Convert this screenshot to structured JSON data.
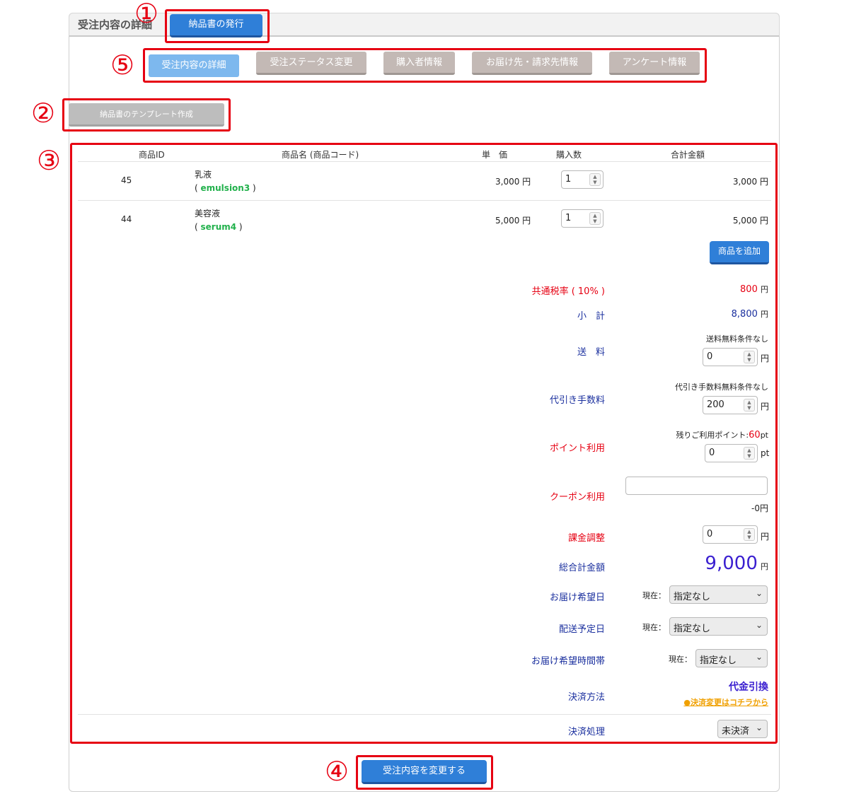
{
  "header": {
    "title": "受注内容の詳細",
    "issue_button": "納品書の発行"
  },
  "callouts": [
    "①",
    "②",
    "③",
    "④",
    "⑤"
  ],
  "tabs": [
    {
      "label": "受注内容の詳細",
      "active": true
    },
    {
      "label": "受注ステータス変更",
      "active": false
    },
    {
      "label": "購入者情報",
      "active": false
    },
    {
      "label": "お届け先・請求先情報",
      "active": false
    },
    {
      "label": "アンケート情報",
      "active": false
    }
  ],
  "template_button": "納品書のテンプレート作成",
  "table": {
    "headers": [
      "商品ID",
      "商品名 (商品コード)",
      "単　価",
      "購入数",
      "合計金額"
    ],
    "rows": [
      {
        "id": "45",
        "name": "乳液",
        "code": "emulsion3",
        "price": "3,000 円",
        "qty": "1",
        "total": "3,000 円"
      },
      {
        "id": "44",
        "name": "美容液",
        "code": "serum4",
        "price": "5,000 円",
        "qty": "1",
        "total": "5,000 円"
      }
    ],
    "add_button": "商品を追加",
    "paren_open": "( ",
    "paren_close": " )"
  },
  "summary": {
    "tax_label": "共通税率 ( 10% )",
    "tax_value": "800",
    "subtotal_label": "小　計",
    "subtotal_value": "8,800",
    "shipping_label": "送　料",
    "shipping_note": "送料無料条件なし",
    "shipping_value": "0",
    "cod_label": "代引き手数料",
    "cod_note": "代引き手数料無料条件なし",
    "cod_value": "200",
    "point_label": "ポイント利用",
    "point_note_prefix": "残りご利用ポイント:",
    "point_remaining": "60",
    "point_unit": "pt",
    "point_value": "0",
    "coupon_label": "クーポン利用",
    "coupon_value": "",
    "coupon_discount": "-0円",
    "adjust_label": "課金調整",
    "adjust_value": "0",
    "grand_label": "総合計金額",
    "grand_value": "9,000",
    "yen": "円",
    "delivery_date_label": "お届け希望日",
    "ship_date_label": "配送予定日",
    "delivery_time_label": "お届け希望時間帯",
    "current_prefix": "現在：",
    "not_specified": "指定なし",
    "payment_label": "決済方法",
    "payment_value": "代金引換",
    "payment_change_link": "●決済変更はコチラから",
    "process_label": "決済処理",
    "process_value": "未決済"
  },
  "submit_button": "受注内容を変更する",
  "colors": {
    "accent": "#2f7fd8",
    "callout": "#e60012",
    "tab_inactive": "#c3b9b5",
    "tab_active": "#7db8ee",
    "code_green": "#22b14c",
    "navy": "#1a2f9e",
    "grand_total": "#3a1fd0",
    "link_orange": "#f0a000"
  }
}
